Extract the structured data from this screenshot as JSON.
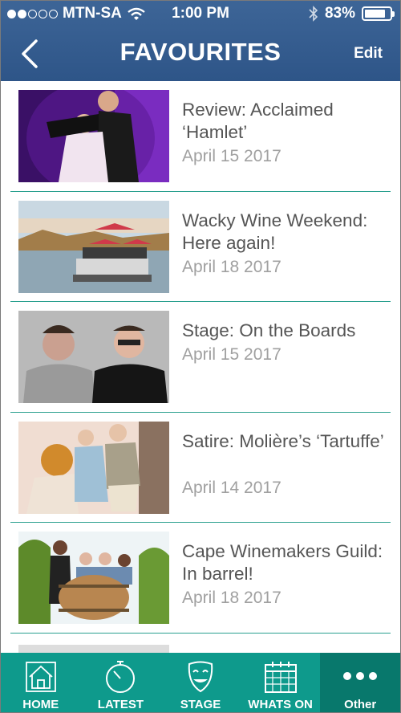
{
  "status_bar": {
    "carrier": "MTN-SA",
    "time": "1:00 PM",
    "battery_percent": "83%",
    "battery_level": 0.83,
    "signal_bars_filled": 2,
    "signal_bars_total": 5,
    "wifi_icon": "wifi-icon",
    "bluetooth_icon": "bluetooth-icon"
  },
  "nav": {
    "title": "FAVOURITES",
    "back_icon": "chevron-left-icon",
    "edit_label": "Edit"
  },
  "items": [
    {
      "title": "Review: Acclaimed ‘Hamlet’",
      "date": "April 15 2017"
    },
    {
      "title": "Wacky Wine Weekend: Here again!",
      "date": "April 18 2017"
    },
    {
      "title": "Stage: On the Boards",
      "date": "April 15 2017"
    },
    {
      "title": "Satire: Molière’s ‘Tartuffe’",
      "date": "April 14 2017"
    },
    {
      "title": "Cape Winemakers Guild: In barrel!",
      "date": "April 18 2017"
    }
  ],
  "tabs": [
    {
      "label": "HOME",
      "icon": "home-icon",
      "active": false
    },
    {
      "label": "LATEST",
      "icon": "stopwatch-icon",
      "active": false
    },
    {
      "label": "STAGE",
      "icon": "theatre-mask-icon",
      "active": false
    },
    {
      "label": "WHATS ON",
      "icon": "calendar-icon",
      "active": false
    },
    {
      "label": "Other",
      "icon": "more-dots-icon",
      "active": true
    }
  ],
  "colors": {
    "header": "#2e5588",
    "tabbar": "#0e9a8c",
    "tab_active": "#08786c",
    "divider": "#2aa08f",
    "title_text": "#555555",
    "date_text": "#a0a0a0"
  }
}
